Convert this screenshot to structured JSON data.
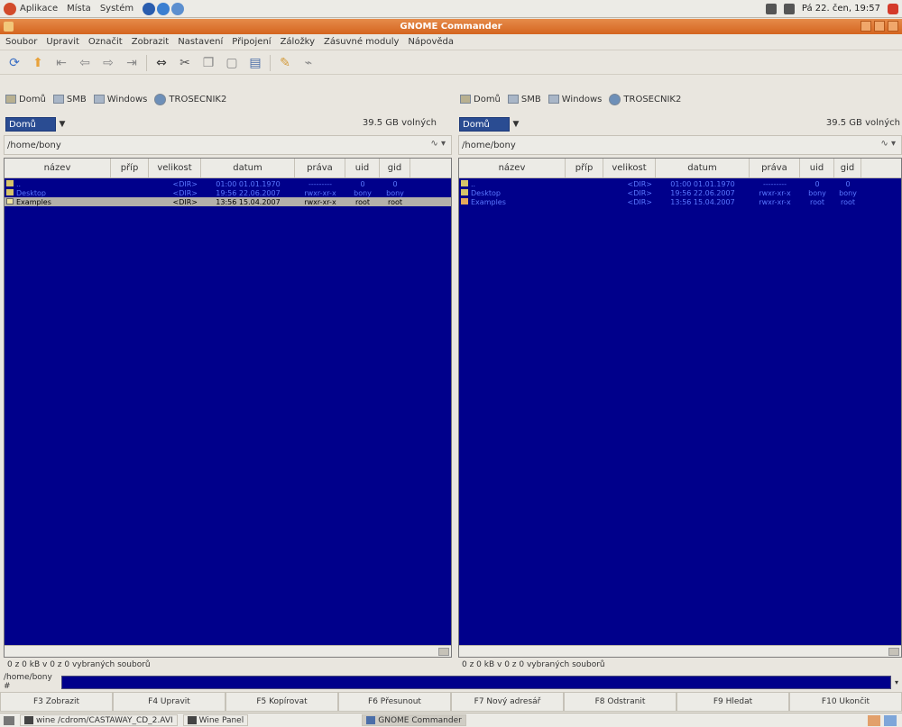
{
  "panel": {
    "menus": [
      "Aplikace",
      "Místa",
      "Systém"
    ],
    "clock": "Pá 22. čen, 19:57"
  },
  "window": {
    "title": "GNOME Commander"
  },
  "menubar": [
    "Soubor",
    "Upravit",
    "Označit",
    "Zobrazit",
    "Nastavení",
    "Připojení",
    "Záložky",
    "Zásuvné moduly",
    "Nápověda"
  ],
  "toolbar": {
    "icons": [
      "refresh-icon",
      "up-icon",
      "first-icon",
      "back-icon",
      "forward-icon",
      "last-icon",
      "connect-icon",
      "cut-icon",
      "copy-icon",
      "paste-icon",
      "delete-icon",
      "edit-icon",
      "terminal-icon"
    ]
  },
  "left": {
    "bookmarks": [
      "Domů",
      "SMB",
      "Windows",
      "TROSECNIK2"
    ],
    "device": "Domů",
    "free": "39.5 GB volných",
    "path": "/home/bony",
    "columns": [
      "název",
      "příp",
      "velikost",
      "datum",
      "práva",
      "uid",
      "gid"
    ],
    "rows": [
      {
        "name": "..",
        "ext": "",
        "size": "<DIR>",
        "date": "01:00 01.01.1970",
        "perm": "---------",
        "uid": "0",
        "gid": "0"
      },
      {
        "name": "Desktop",
        "ext": "",
        "size": "<DIR>",
        "date": "19:56 22.06.2007",
        "perm": "rwxr-xr-x",
        "uid": "bony",
        "gid": "bony"
      },
      {
        "name": "Examples",
        "ext": "",
        "size": "<DIR>",
        "date": "13:56 15.04.2007",
        "perm": "rwxr-xr-x",
        "uid": "root",
        "gid": "root"
      }
    ],
    "status": "0 z 0 kB v 0 z 0 vybraných souborů"
  },
  "right": {
    "bookmarks": [
      "Domů",
      "SMB",
      "Windows",
      "TROSECNIK2"
    ],
    "device": "Domů",
    "free": "39.5 GB volných",
    "path": "/home/bony",
    "columns": [
      "název",
      "příp",
      "velikost",
      "datum",
      "práva",
      "uid",
      "gid"
    ],
    "rows": [
      {
        "name": "..",
        "ext": "",
        "size": "<DIR>",
        "date": "01:00 01.01.1970",
        "perm": "---------",
        "uid": "0",
        "gid": "0"
      },
      {
        "name": "Desktop",
        "ext": "",
        "size": "<DIR>",
        "date": "19:56 22.06.2007",
        "perm": "rwxr-xr-x",
        "uid": "bony",
        "gid": "bony"
      },
      {
        "name": "Examples",
        "ext": "",
        "size": "<DIR>",
        "date": "13:56 15.04.2007",
        "perm": "rwxr-xr-x",
        "uid": "root",
        "gid": "root"
      }
    ],
    "status": "0 z 0 kB v 0 z 0 vybraných souborů"
  },
  "cmdline": {
    "prompt": "/home/bony #"
  },
  "fkeys": [
    "F3 Zobrazit",
    "F4 Upravit",
    "F5 Kopírovat",
    "F6 Přesunout",
    "F7 Nový adresář",
    "F8 Odstranit",
    "F9 Hledat",
    "F10 Ukončit"
  ],
  "taskbar": {
    "tasks": [
      "wine /cdrom/CASTAWAY_CD_2.AVI",
      "Wine Panel",
      "GNOME Commander"
    ]
  }
}
